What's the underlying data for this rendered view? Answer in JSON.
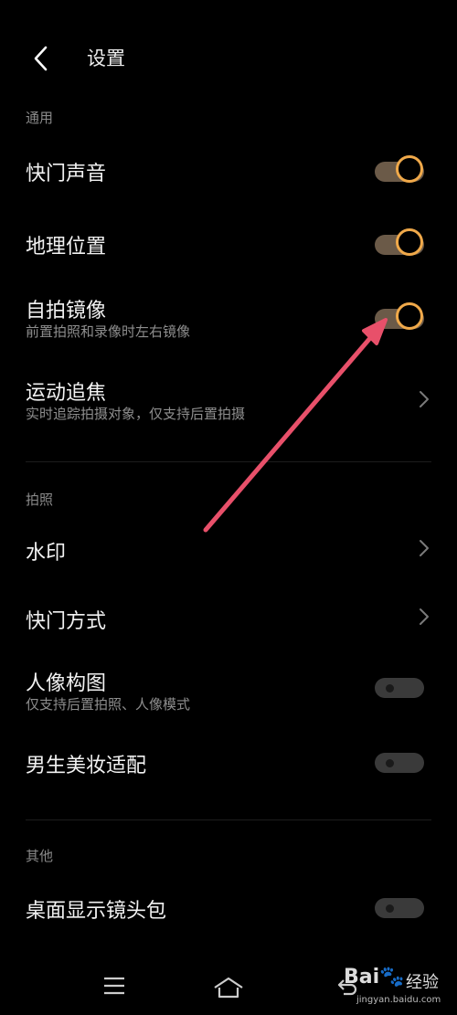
{
  "header": {
    "title": "设置"
  },
  "sections": {
    "general": "通用",
    "photo": "拍照",
    "other": "其他"
  },
  "rows": {
    "shutter_sound": {
      "title": "快门声音",
      "enabled": true
    },
    "location": {
      "title": "地理位置",
      "enabled": true
    },
    "selfie_mirror": {
      "title": "自拍镜像",
      "subtitle": "前置拍照和录像时左右镜像",
      "enabled": true
    },
    "motion_focus": {
      "title": "运动追焦",
      "subtitle": "实时追踪拍摄对象，仅支持后置拍摄"
    },
    "watermark": {
      "title": "水印"
    },
    "shutter_mode": {
      "title": "快门方式"
    },
    "portrait_composition": {
      "title": "人像构图",
      "subtitle": "仅支持后置拍照、人像模式",
      "enabled": false
    },
    "male_beauty": {
      "title": "男生美妆适配",
      "enabled": false
    },
    "desktop_lens_pack": {
      "title": "桌面显示镜头包",
      "enabled": false
    }
  },
  "watermark_overlay": {
    "logo": "Bai🐾",
    "text": "经验",
    "url": "jingyan.baidu.com"
  },
  "colors": {
    "accent": "#f0a94a",
    "arrow": "#e8506a",
    "background": "#000000"
  }
}
